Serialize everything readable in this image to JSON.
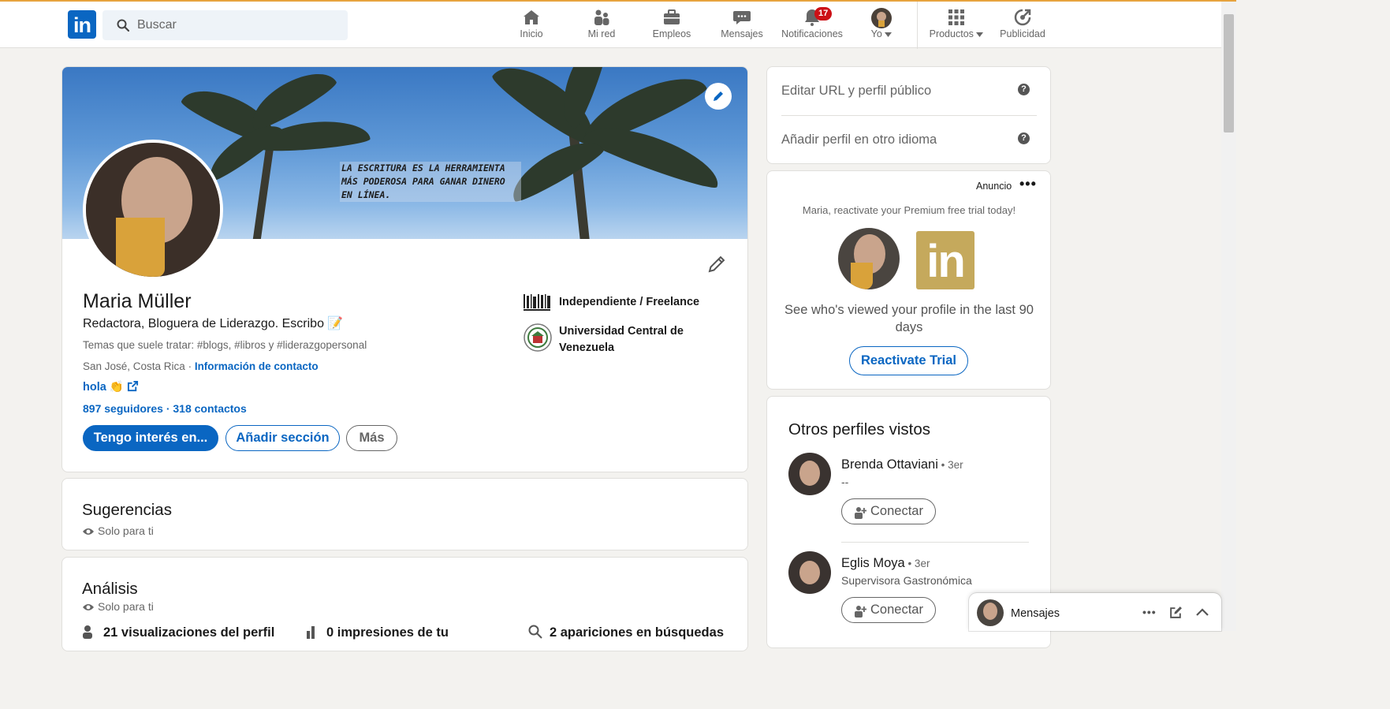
{
  "nav": {
    "search_placeholder": "Buscar",
    "items": [
      {
        "label": "Inicio",
        "icon": "home-icon"
      },
      {
        "label": "Mi red",
        "icon": "network-icon"
      },
      {
        "label": "Empleos",
        "icon": "briefcase-icon"
      },
      {
        "label": "Mensajes",
        "icon": "messaging-icon"
      },
      {
        "label": "Notificaciones",
        "icon": "bell-icon",
        "badge": "17"
      },
      {
        "label": "Yo",
        "icon": "avatar"
      },
      {
        "label": "Productos",
        "icon": "grid-icon"
      },
      {
        "label": "Publicidad",
        "icon": "advertise-icon"
      }
    ]
  },
  "profile": {
    "banner_quote": "La escritura es la herramienta más poderosa para ganar dinero en línea.",
    "name": "Maria Müller",
    "headline": "Redactora, Bloguera de Liderazgo. Escribo 📝",
    "topics": "Temas que suele tratar: #blogs, #libros y #liderazgopersonal",
    "location": "San José, Costa Rica",
    "location_sep": " · ",
    "contact_info": "Información de contacto",
    "website": "hola 👏",
    "followers": "897 seguidores",
    "counts_sep": " · ",
    "connections": "318 contactos",
    "btn_open_to": "Tengo interés en...",
    "btn_add_section": "Añadir sección",
    "btn_more": "Más",
    "experience": "Independiente / Freelance",
    "education": "Universidad Central de Venezuela"
  },
  "sections": {
    "suggestions_title": "Sugerencias",
    "suggestions_private": "Solo para ti",
    "analytics_title": "Análisis",
    "analytics_private": "Solo para ti",
    "analytics_items": [
      "21 visualizaciones del perfil",
      "0 impresiones de tu",
      "2 apariciones en búsquedas"
    ]
  },
  "right": {
    "edit_url": "Editar URL y perfil público",
    "add_language": "Añadir perfil en otro idioma",
    "help_glyph": "?",
    "ad_label": "Anuncio",
    "ad_menu": "•••",
    "ad_tagline": "Maria, reactivate your Premium free trial today!",
    "ad_logo": "in",
    "ad_text": "See who's viewed your profile in the last 90 days",
    "ad_button": "Reactivate Trial",
    "pv_title": "Otros perfiles vistos",
    "people": [
      {
        "name": "Brenda Ottaviani",
        "degree": " • 3er",
        "subtitle": "--",
        "button": "Conectar"
      },
      {
        "name": "Eglis Moya",
        "degree": " • 3er",
        "subtitle": "Supervisora Gastronómica",
        "button": "Conectar"
      }
    ]
  },
  "messaging": {
    "title": "Mensajes",
    "menu": "•••"
  },
  "colors": {
    "brand": "#0a66c2",
    "badge": "#cc1016",
    "background": "#f3f2ef"
  }
}
